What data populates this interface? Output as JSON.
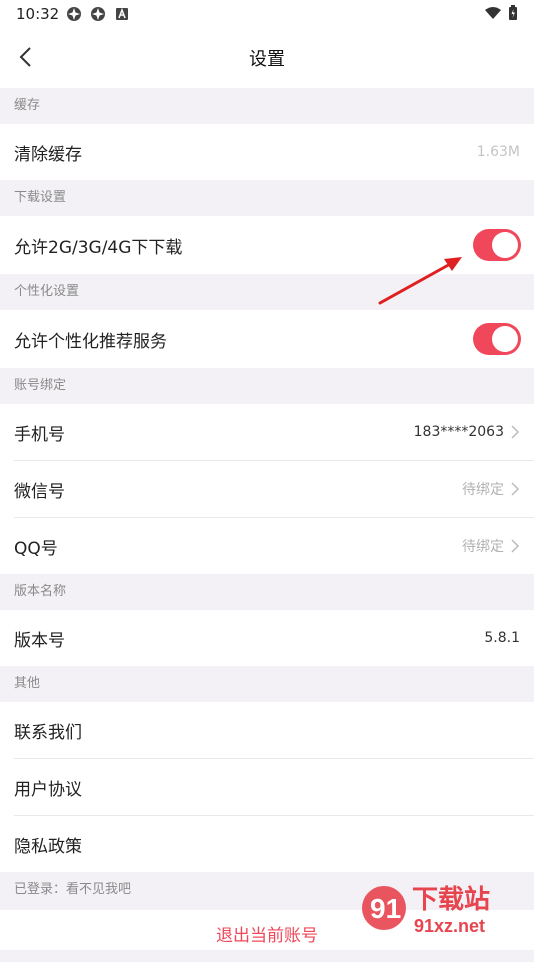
{
  "status_bar": {
    "time": "10:32"
  },
  "nav": {
    "title": "设置"
  },
  "sections": {
    "cache": {
      "header": "缓存",
      "clear_label": "清除缓存",
      "clear_value": "1.63M"
    },
    "download": {
      "header": "下载设置",
      "allow_label": "允许2G/3G/4G下下载",
      "allow_on": true
    },
    "personal": {
      "header": "个性化设置",
      "allow_label": "允许个性化推荐服务",
      "allow_on": true
    },
    "account": {
      "header": "账号绑定",
      "phone_label": "手机号",
      "phone_value": "183****2063",
      "wechat_label": "微信号",
      "wechat_value": "待绑定",
      "qq_label": "QQ号",
      "qq_value": "待绑定"
    },
    "version": {
      "header": "版本名称",
      "label": "版本号",
      "value": "5.8.1"
    },
    "other": {
      "header": "其他",
      "contact": "联系我们",
      "agreement": "用户协议",
      "privacy": "隐私政策"
    }
  },
  "login_status": "已登录：看不见我吧",
  "logout_label": "退出当前账号",
  "watermark": {
    "main": "下载站",
    "sub": "91xz.net"
  },
  "colors": {
    "accent": "#f0485a",
    "arrow": "#e02020"
  }
}
